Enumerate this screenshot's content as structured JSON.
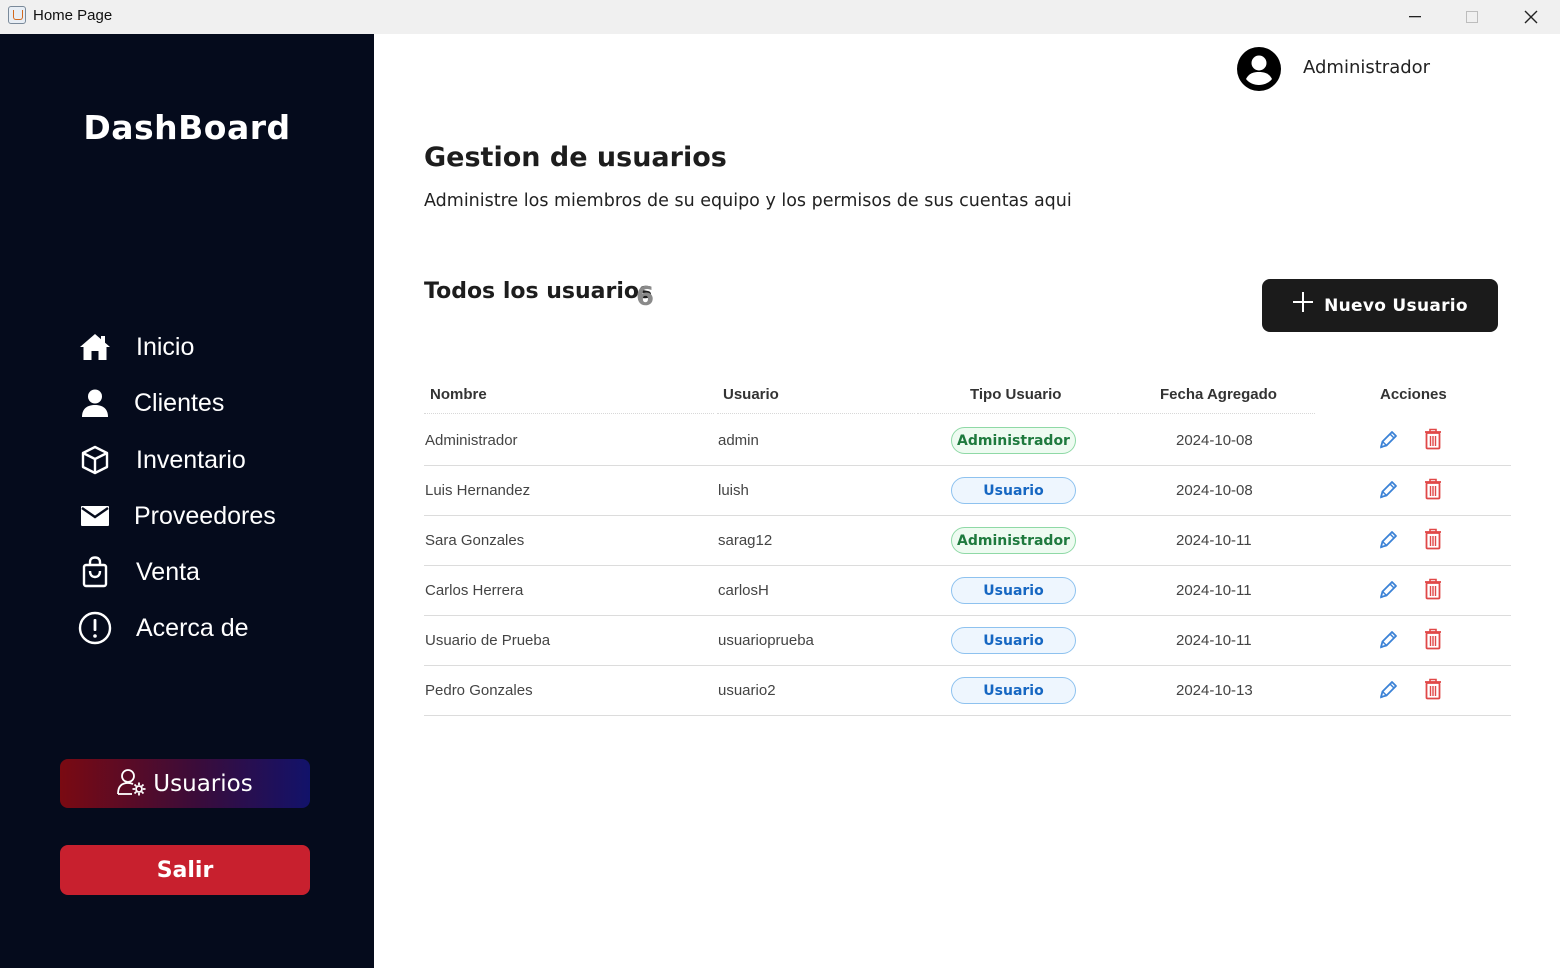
{
  "window": {
    "title": "Home Page"
  },
  "sidebar": {
    "brand": "DashBoard",
    "items": [
      {
        "label": "Inicio",
        "icon": "home-icon"
      },
      {
        "label": "Clientes",
        "icon": "person-icon"
      },
      {
        "label": "Inventario",
        "icon": "box-icon"
      },
      {
        "label": "Proveedores",
        "icon": "mail-icon"
      },
      {
        "label": "Venta",
        "icon": "shopping-bag-icon"
      },
      {
        "label": "Acerca de",
        "icon": "info-icon"
      }
    ],
    "active_button": {
      "label": "Usuarios",
      "icon": "user-settings-icon"
    },
    "exit_button": {
      "label": "Salir"
    }
  },
  "header": {
    "user_name": "Administrador",
    "avatar_icon": "account-circle-icon"
  },
  "main": {
    "title": "Gestion de usuarios",
    "subtitle": "Administre los miembros de su equipo y los permisos de sus cuentas aqui",
    "section_title": "Todos los usuarios",
    "count": "6",
    "new_button": {
      "label": "Nuevo Usuario",
      "icon": "plus-icon"
    }
  },
  "table": {
    "headers": {
      "nombre": "Nombre",
      "usuario": "Usuario",
      "tipo": "Tipo Usuario",
      "fecha": "Fecha Agregado",
      "acciones": "Acciones"
    },
    "rows": [
      {
        "nombre": "Administrador",
        "usuario": "admin",
        "tipo": "Administrador",
        "fecha": "2024-10-08"
      },
      {
        "nombre": "Luis Hernandez",
        "usuario": "luish",
        "tipo": "Usuario",
        "fecha": "2024-10-08"
      },
      {
        "nombre": "Sara Gonzales",
        "usuario": "sarag12",
        "tipo": "Administrador",
        "fecha": "2024-10-11"
      },
      {
        "nombre": "Carlos Herrera",
        "usuario": "carlosH",
        "tipo": "Usuario",
        "fecha": "2024-10-11"
      },
      {
        "nombre": "Usuario de Prueba",
        "usuario": "usuarioprueba",
        "tipo": "Usuario",
        "fecha": "2024-10-11"
      },
      {
        "nombre": "Pedro Gonzales",
        "usuario": "usuario2",
        "tipo": "Usuario",
        "fecha": "2024-10-13"
      }
    ]
  },
  "colors": {
    "sidebar_bg": "#050b1c",
    "exit_red": "#c8202e",
    "admin_badge_text": "#1f7a3e",
    "user_badge_text": "#1667c2",
    "edit_icon": "#3b82d6",
    "delete_icon": "#e04848"
  }
}
